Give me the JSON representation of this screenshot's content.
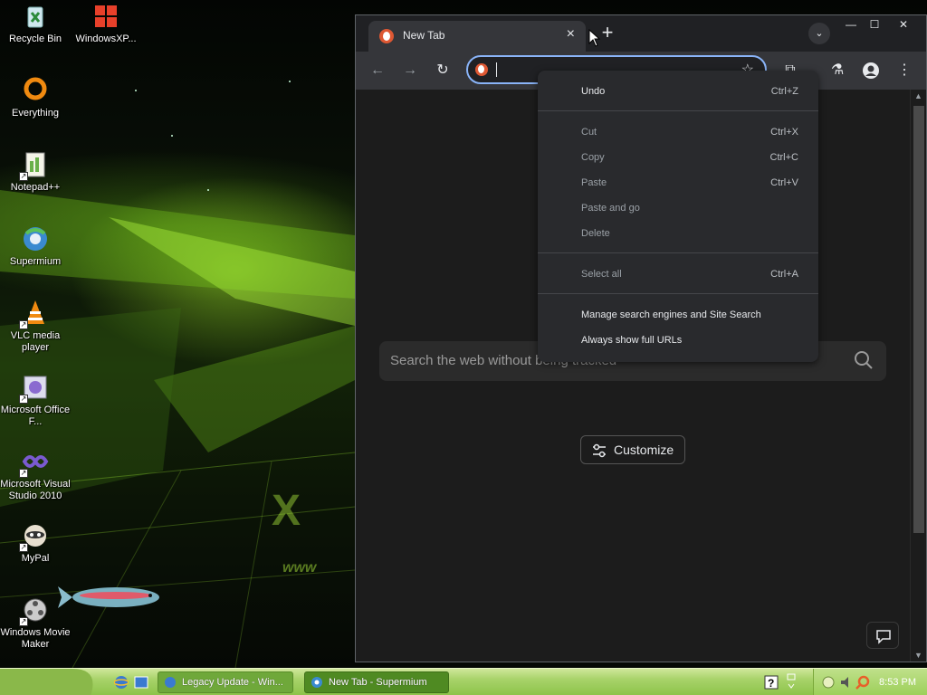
{
  "desktop": {
    "icons": [
      {
        "label": "Recycle Bin"
      },
      {
        "label": "WindowsXP..."
      },
      {
        "label": "Everything"
      },
      {
        "label": "Notepad++"
      },
      {
        "label": "Supermium"
      },
      {
        "label": "VLC media player"
      },
      {
        "label": "Microsoft Office F..."
      },
      {
        "label": "Microsoft Visual Studio 2010"
      },
      {
        "label": "MyPal"
      },
      {
        "label": "Windows Movie Maker"
      }
    ]
  },
  "browser": {
    "tab_title": "New Tab",
    "tab_close": "×",
    "new_tab": "+",
    "tab_search": "⌄",
    "window_controls": {
      "minimize": "—",
      "maximize": "☐",
      "close": "✕"
    },
    "nav": {
      "back": "←",
      "forward": "→",
      "reload": "↻"
    },
    "omnibox": {
      "value": "",
      "star": "☆"
    },
    "toolbar": {
      "extensions": "⧉",
      "labs": "⚗",
      "menu": "⋮"
    },
    "search_placeholder": "Search the web without being tracked",
    "customize_label": "Customize"
  },
  "context_menu": {
    "undo": {
      "label": "Undo",
      "shortcut": "Ctrl+Z"
    },
    "cut": {
      "label": "Cut",
      "shortcut": "Ctrl+X"
    },
    "copy": {
      "label": "Copy",
      "shortcut": "Ctrl+C"
    },
    "paste": {
      "label": "Paste",
      "shortcut": "Ctrl+V"
    },
    "paste_and_go": {
      "label": "Paste and go"
    },
    "delete": {
      "label": "Delete"
    },
    "select_all": {
      "label": "Select all",
      "shortcut": "Ctrl+A"
    },
    "manage_search": {
      "label": "Manage search engines and Site Search"
    },
    "show_full_urls": {
      "label": "Always show full URLs"
    }
  },
  "taskbar": {
    "buttons": [
      {
        "label": "Legacy Update - Win..."
      },
      {
        "label": "New Tab - Supermium"
      }
    ],
    "clock": "8:53 PM"
  },
  "colors": {
    "accent": "#8ab4f8",
    "taskbar": "#a8d36a",
    "menu_bg": "#292a2d",
    "duckduckgo": "#de5833"
  }
}
